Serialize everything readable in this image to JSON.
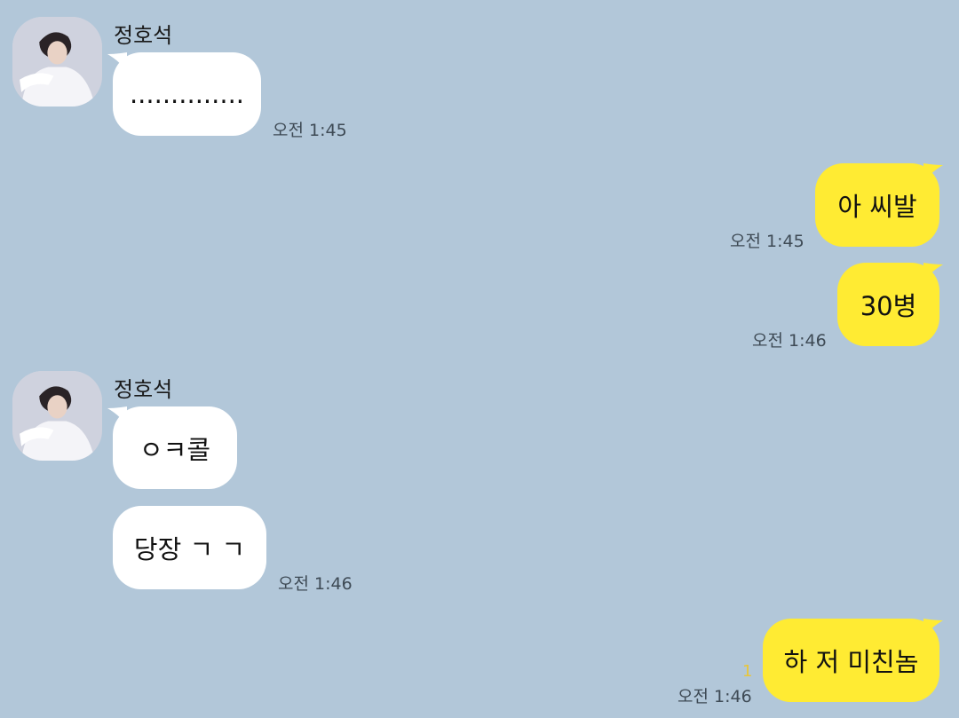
{
  "colors": {
    "background": "#b2c7d9",
    "incoming_bubble": "#ffffff",
    "outgoing_bubble": "#ffeb33",
    "unread_count": "#e8c63a"
  },
  "messages": [
    {
      "sender": "정호석",
      "text": "..............",
      "time": "오전 1:45"
    },
    {
      "text": "아 씨발",
      "time": "오전 1:45"
    },
    {
      "text": "30병",
      "time": "오전 1:46"
    },
    {
      "sender": "정호석",
      "text": "ㅇㅋ콜"
    },
    {
      "text": "당장 ㄱ ㄱ",
      "time": "오전 1:46"
    },
    {
      "text": "하 저 미친놈",
      "time": "오전 1:46",
      "unread": "1"
    }
  ],
  "avatar_icon": "profile-photo"
}
